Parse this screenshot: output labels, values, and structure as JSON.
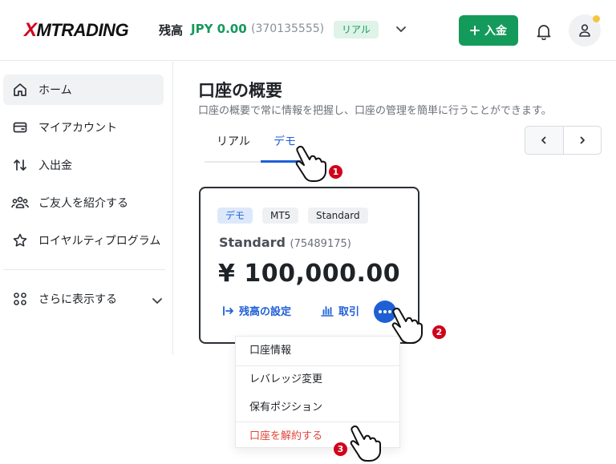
{
  "header": {
    "logo_x": "X",
    "logo_rest": "MTRADING",
    "balance_label": "残高",
    "balance_value": "JPY 0.00",
    "account_number": "(370135555)",
    "account_type_badge": "リアル",
    "deposit_label": "入金",
    "deposit_icon": "plus-icon",
    "brand_color": "#149a5a"
  },
  "sidebar": {
    "items": [
      {
        "label": "ホーム",
        "icon": "home-icon"
      },
      {
        "label": "マイアカウント",
        "icon": "wallet-icon"
      },
      {
        "label": "入出金",
        "icon": "transfer-arrows-icon"
      },
      {
        "label": "ご友人を紹介する",
        "icon": "users-icon"
      },
      {
        "label": "ロイヤルティプログラム",
        "icon": "star-icon"
      },
      {
        "label": "さらに表示する",
        "icon": "grid-icon"
      }
    ]
  },
  "main": {
    "title": "口座の概要",
    "subtitle": "口座の概要で常に情報を把握し、口座の管理を簡単に行うことができます。",
    "tabs": [
      {
        "label": "リアル"
      },
      {
        "label": "デモ"
      }
    ],
    "active_tab": "デモ",
    "accent_color": "#1f5fd6"
  },
  "card": {
    "chips": [
      "デモ",
      "MT5",
      "Standard"
    ],
    "account_name": "Standard",
    "account_id": "(75489175)",
    "balance": "¥ 100,000.00",
    "set_balance_label": "残高の設定",
    "trade_label": "取引"
  },
  "menu": {
    "items": [
      "口座情報",
      "レバレッジ変更",
      "保有ポジション",
      "口座を解約する"
    ],
    "danger_color": "#e0453a"
  },
  "steps": [
    "1",
    "2",
    "3"
  ]
}
